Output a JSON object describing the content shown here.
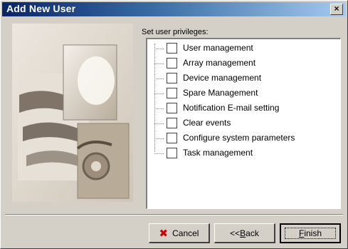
{
  "window": {
    "title": "Add New User",
    "close_symbol": "×"
  },
  "privileges": {
    "group_label": "Set user privileges:",
    "items": [
      {
        "label": "User management",
        "checked": false
      },
      {
        "label": "Array management",
        "checked": false
      },
      {
        "label": "Device management",
        "checked": false
      },
      {
        "label": "Spare Management",
        "checked": false
      },
      {
        "label": "Notification E-mail setting",
        "checked": false
      },
      {
        "label": "Clear events",
        "checked": false
      },
      {
        "label": "Configure system parameters",
        "checked": false
      },
      {
        "label": "Task management",
        "checked": false
      }
    ]
  },
  "buttons": {
    "cancel_icon": "✖",
    "cancel_label": "Cancel",
    "back_prefix": "<<",
    "back_mnemonic": "B",
    "back_rest": "ack",
    "finish_mnemonic": "F",
    "finish_rest": "inish"
  },
  "colors": {
    "title_gradient_start": "#0a246a",
    "title_gradient_end": "#a6caf0",
    "cancel_icon": "#cc0000",
    "dialog_face": "#d4d0c8"
  }
}
